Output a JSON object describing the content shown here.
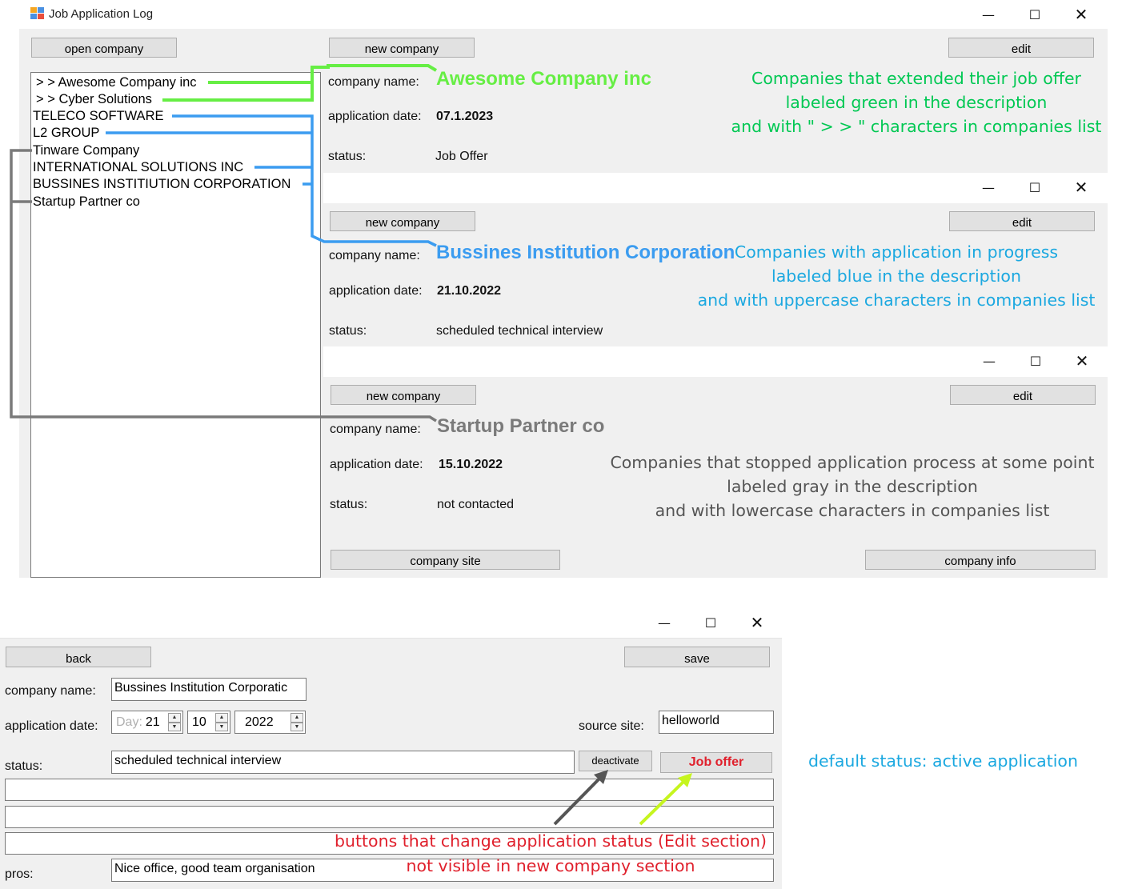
{
  "main_window": {
    "title": "Job Application Log",
    "open_company_label": "open company",
    "company_list": [
      "> > Awesome Company inc",
      "> > Cyber Solutions",
      "TELECO SOFTWARE",
      "L2 GROUP",
      "Tinware Company",
      "INTERNATIONAL SOLUTIONS INC",
      "BUSSINES INSTITIUTION CORPORATION",
      "Startup Partner co"
    ]
  },
  "field_labels": {
    "company_name": "company name:",
    "application_date": "application date:",
    "status": "status:"
  },
  "panels": [
    {
      "new_company_label": "new company",
      "edit_label": "edit",
      "company_name": "Awesome Company inc",
      "application_date": "07.1.2023",
      "status": "Job Offer",
      "note_lines": [
        "Companies that extended their job offer",
        "labeled green in the description",
        "and with \" > > \" characters in companies list"
      ]
    },
    {
      "new_company_label": "new company",
      "edit_label": "edit",
      "company_name": "Bussines Institution Corporation",
      "application_date": "21.10.2022",
      "status": "scheduled technical interview",
      "note_lines": [
        "Companies with application in progress",
        "labeled blue in the description",
        "and with uppercase characters in companies list"
      ]
    },
    {
      "new_company_label": "new company",
      "edit_label": "edit",
      "company_name": "Startup Partner co",
      "application_date": "15.10.2022",
      "status": "not contacted",
      "company_site_label": "company site",
      "company_info_label": "company info",
      "note_lines": [
        "Companies that stopped application process at some point",
        "labeled gray in the description",
        "and with lowercase characters in companies list"
      ]
    }
  ],
  "edit_window": {
    "back_label": "back",
    "save_label": "save",
    "company_name_label": "company name:",
    "company_name_value": "Bussines Institution Corporatic",
    "application_date_label": "application date:",
    "day_prefix": "Day:",
    "day_value": "21",
    "month_value": "10",
    "year_value": "2022",
    "source_site_label": "source site:",
    "source_site_value": "helloworld",
    "status_label": "status:",
    "status_value": "scheduled technical interview",
    "deactivate_label": "deactivate",
    "job_offer_label": "Job offer",
    "pros_label": "pros:",
    "pros_value": "Nice office, good team organisation",
    "note_lines": [
      "buttons that change application status (Edit section)",
      "not visible in new company section"
    ]
  },
  "default_status_note": "default status: active application",
  "colors": {
    "green": "#66ee44",
    "green_text": "#00c853",
    "blue": "#3b9cf0",
    "blue_text": "#1ba8e0",
    "gray": "#7a7a7a",
    "red": "#e0202c",
    "lime_arrow": "#c6f51e",
    "dark_arrow": "#555555"
  }
}
